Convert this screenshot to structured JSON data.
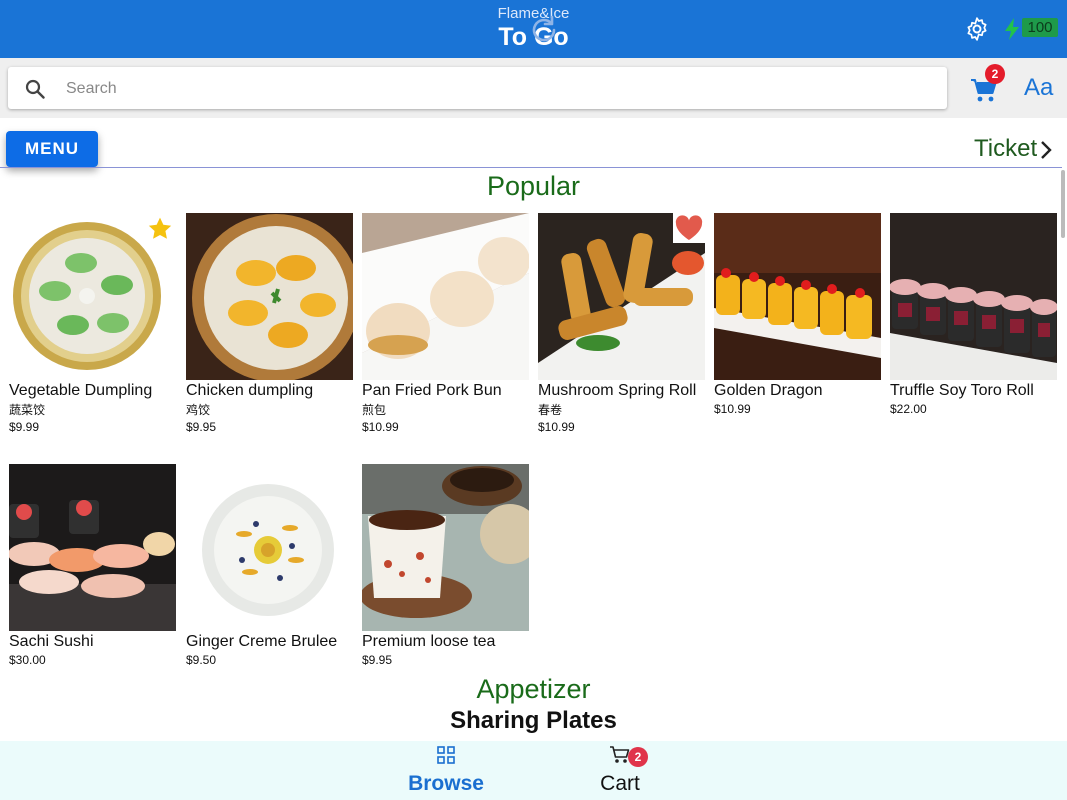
{
  "header": {
    "brand_sub": "Flame&Ice",
    "brand_title": "To Go",
    "battery": "100",
    "colors": {
      "bar": "#1a74d6",
      "battery": "#1e9a4a"
    }
  },
  "search": {
    "placeholder": "Search",
    "value": ""
  },
  "cart_count": "2",
  "font_button": "Aa",
  "menu_button": "MENU",
  "ticket_label": "Ticket",
  "sections": {
    "popular": "Popular",
    "appetizer": "Appetizer",
    "sharing": "Sharing Plates"
  },
  "items": [
    {
      "name": "Vegetable Dumpling",
      "cn": "蔬菜饺",
      "price": "$9.99",
      "badge": "star-icon"
    },
    {
      "name": "Chicken dumpling",
      "cn": "鸡饺",
      "price": "$9.95"
    },
    {
      "name": "Pan Fried Pork Bun",
      "cn": "煎包",
      "price": "$10.99"
    },
    {
      "name": "Mushroom Spring Roll",
      "cn": "春卷",
      "price": "$10.99",
      "badge": "heart-icon"
    },
    {
      "name": "Golden Dragon",
      "cn": "",
      "price": "$10.99"
    },
    {
      "name": "Truffle Soy Toro Roll",
      "cn": "",
      "price": "$22.00"
    },
    {
      "name": "Sachi Sushi",
      "cn": "",
      "price": "$30.00"
    },
    {
      "name": "Ginger Creme Brulee",
      "cn": "",
      "price": "$9.50"
    },
    {
      "name": "Premium loose tea",
      "cn": "",
      "price": "$9.95"
    }
  ],
  "bottom_nav": {
    "browse": "Browse",
    "cart": "Cart",
    "active": "browse"
  }
}
